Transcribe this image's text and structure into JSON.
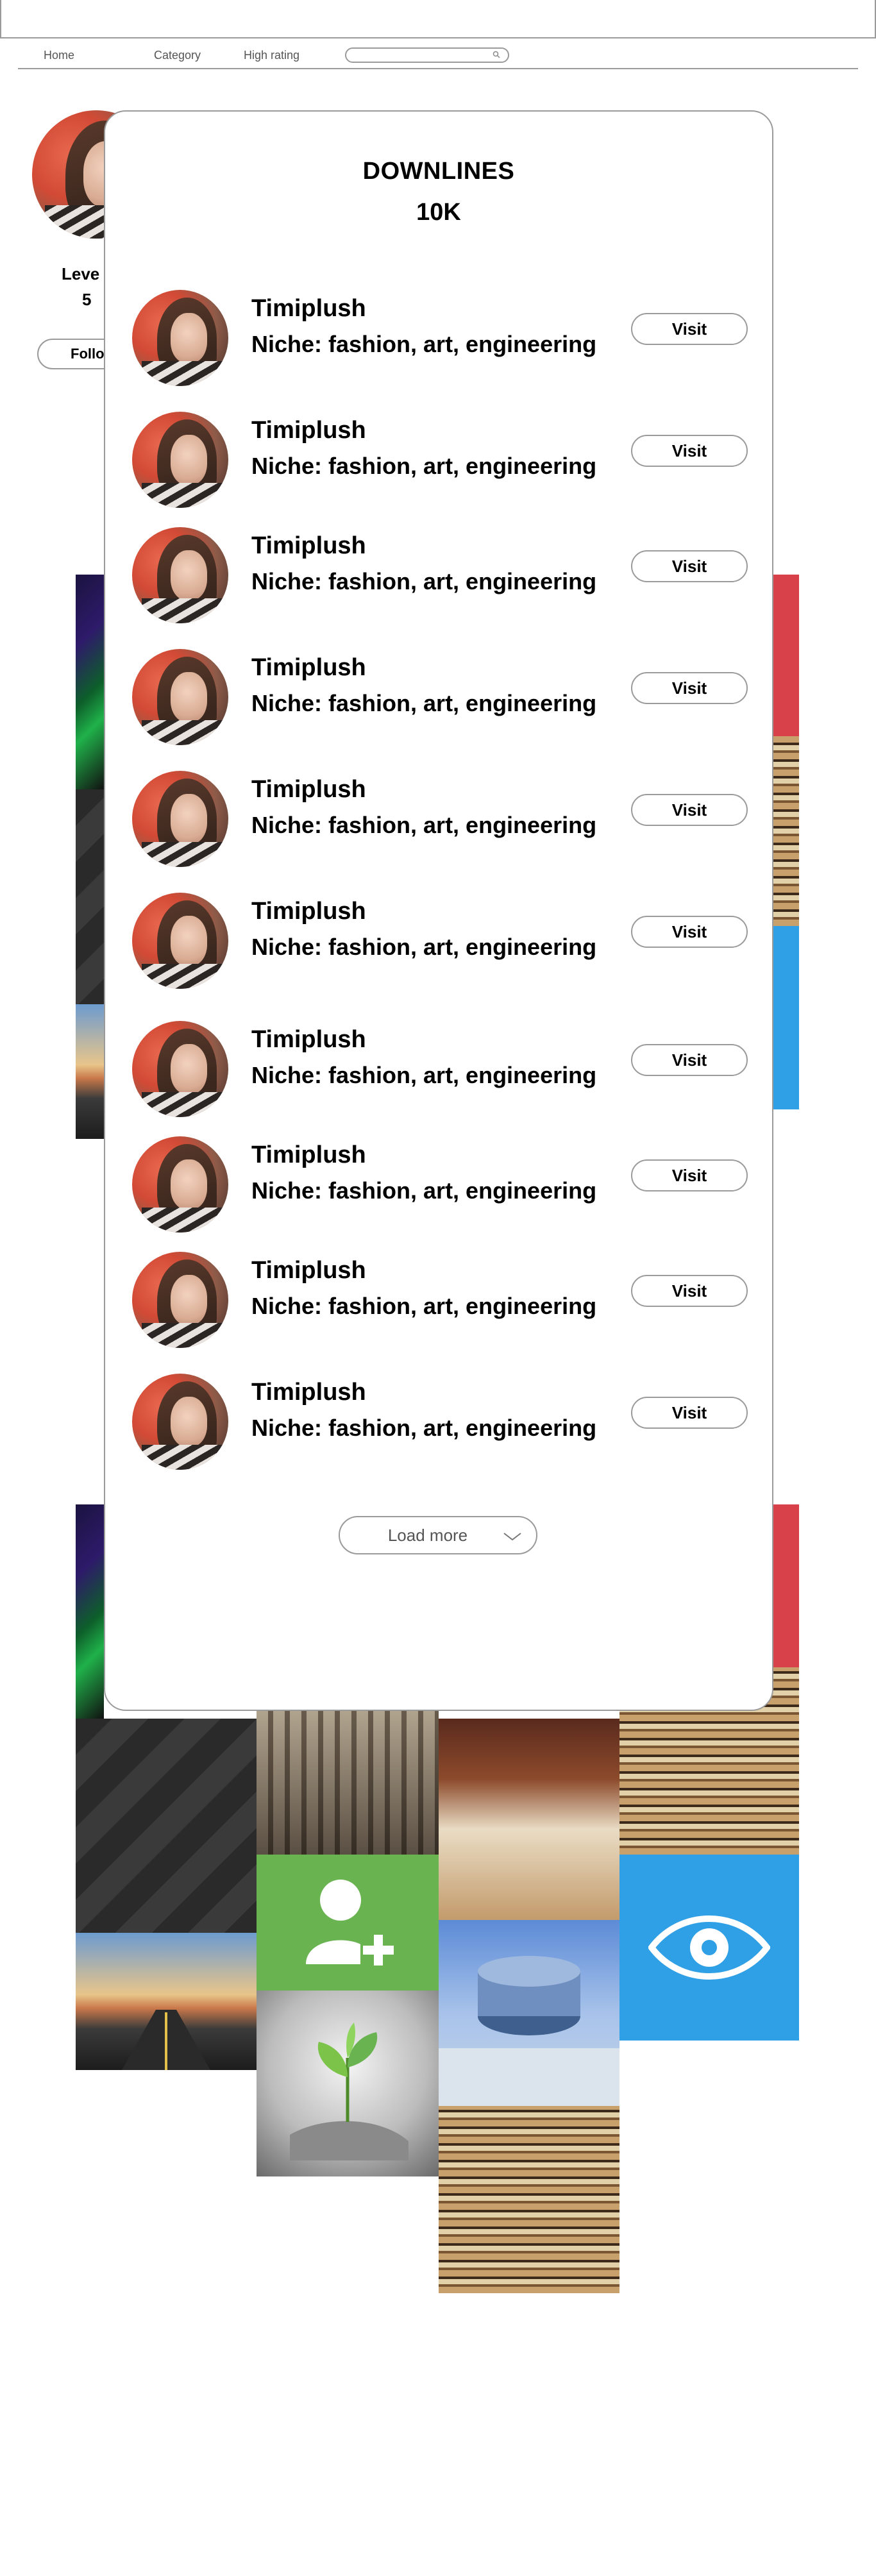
{
  "nav": {
    "links": [
      "Home",
      "Category",
      "High rating"
    ],
    "search_placeholder": ""
  },
  "profile": {
    "level_label": "Leve",
    "level_value": "5",
    "follow_label": "Follo"
  },
  "modal": {
    "title": "DOWNLINES",
    "count": "10K",
    "rows": [
      {
        "name": "Timiplush",
        "niche": "Niche: fashion, art, engineering",
        "button": "Visit"
      },
      {
        "name": "Timiplush",
        "niche": "Niche: fashion, art, engineering",
        "button": "Visit"
      },
      {
        "name": "Timiplush",
        "niche": "Niche: fashion, art, engineering",
        "button": "Visit"
      },
      {
        "name": "Timiplush",
        "niche": "Niche: fashion, art, engineering",
        "button": "Visit"
      },
      {
        "name": "Timiplush",
        "niche": "Niche: fashion, art, engineering",
        "button": "Visit"
      },
      {
        "name": "Timiplush",
        "niche": "Niche: fashion, art, engineering",
        "button": "Visit"
      },
      {
        "name": "Timiplush",
        "niche": "Niche: fashion, art, engineering",
        "button": "Visit"
      },
      {
        "name": "Timiplush",
        "niche": "Niche: fashion, art, engineering",
        "button": "Visit"
      },
      {
        "name": "Timiplush",
        "niche": "Niche: fashion, art, engineering",
        "button": "Visit"
      },
      {
        "name": "Timiplush",
        "niche": "Niche: fashion, art, engineering",
        "button": "Visit"
      }
    ],
    "load_more_label": "Load more"
  },
  "colors": {
    "border": "#9a9a9a",
    "tile_red": "#d9414a",
    "tile_blue": "#2f9fe6",
    "tile_green": "#6ab351"
  },
  "icons": [
    "search-icon",
    "eye-icon",
    "add-user-icon",
    "sprout-icon",
    "chevron-down-icon"
  ]
}
